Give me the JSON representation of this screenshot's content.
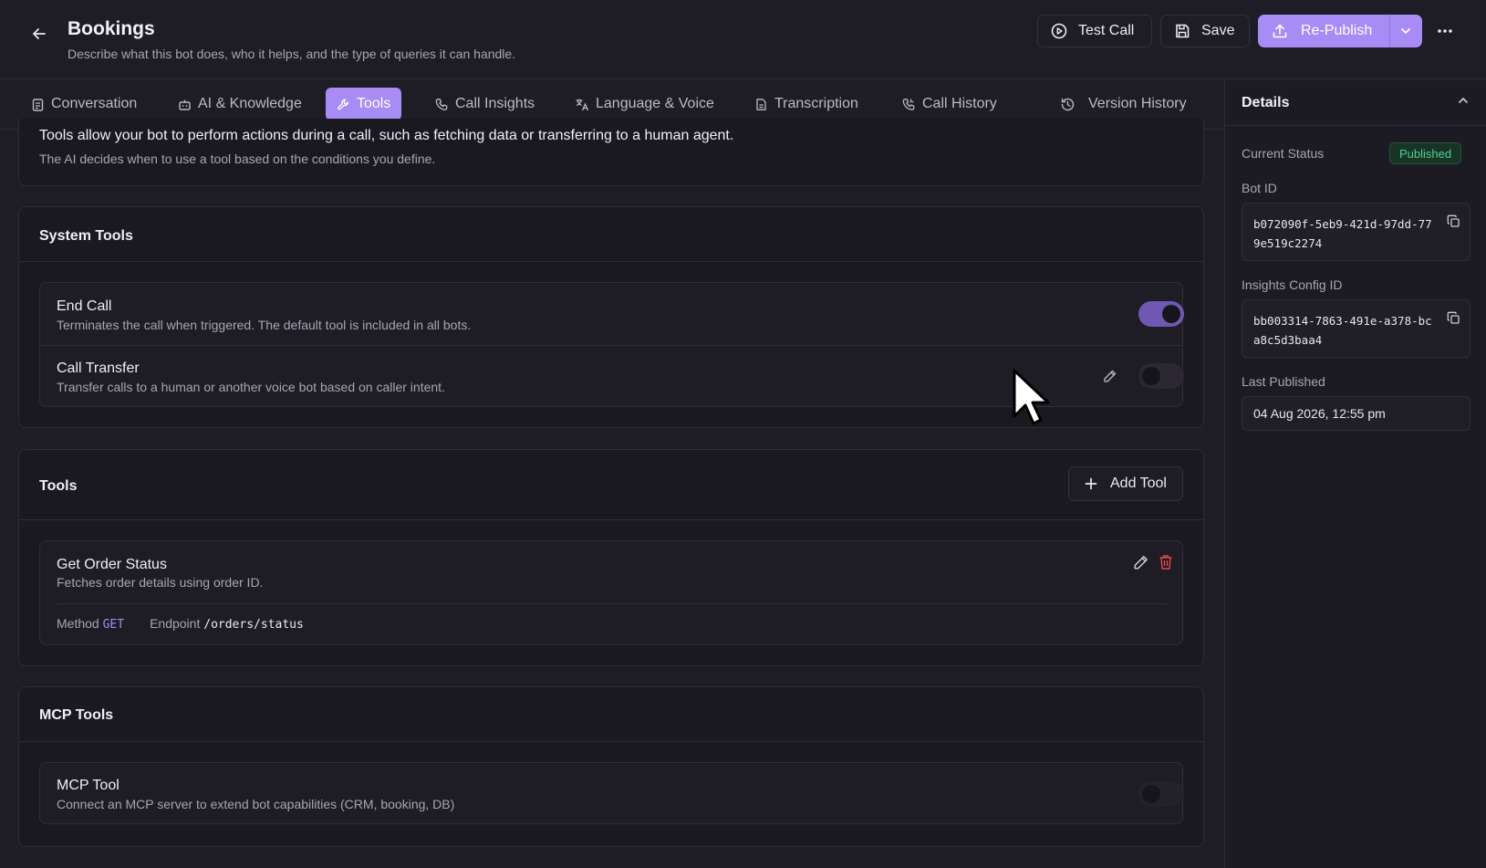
{
  "header": {
    "title": "Bookings",
    "subtitle": "Describe what this bot does, who it helps, and the type of queries it can handle.",
    "test_call_label": "Test Call",
    "save_label": "Save",
    "republish_label": "Re-Publish"
  },
  "tabs": [
    {
      "label": "Conversation",
      "icon": "clipboard-icon"
    },
    {
      "label": "AI & Knowledge",
      "icon": "bot-icon"
    },
    {
      "label": "Tools",
      "icon": "wrench-icon",
      "active": true
    },
    {
      "label": "Call Insights",
      "icon": "phone-icon"
    },
    {
      "label": "Language & Voice",
      "icon": "translate-icon"
    },
    {
      "label": "Transcription",
      "icon": "document-icon"
    },
    {
      "label": "Call History",
      "icon": "phone-history-icon"
    },
    {
      "label": "Version History",
      "icon": "history-icon"
    }
  ],
  "intro": {
    "main": "Tools allow your bot to perform actions during a call, such as fetching data or transferring to a human agent.",
    "sub": "The AI decides when to use a tool based on the conditions you define."
  },
  "system_tools": {
    "title": "System Tools",
    "items": [
      {
        "title": "End Call",
        "desc": "Terminates the call when triggered. The default tool is included in all bots.",
        "enabled": true
      },
      {
        "title": "Call Transfer",
        "desc": "Transfer calls to a human or another voice bot based on caller intent.",
        "enabled": false
      }
    ]
  },
  "tools": {
    "title": "Tools",
    "add_label": "Add Tool",
    "items": [
      {
        "title": "Get Order Status",
        "desc": "Fetches order details using order ID.",
        "method_label": "Method",
        "method": "GET",
        "endpoint_label": "Endpoint",
        "endpoint": "/orders/status"
      }
    ]
  },
  "mcp_tools": {
    "title": "MCP Tools",
    "items": [
      {
        "title": "MCP Tool",
        "desc": "Connect an MCP server to extend bot capabilities (CRM, booking, DB)",
        "enabled": false
      }
    ]
  },
  "details": {
    "title": "Details",
    "status_label": "Current Status",
    "status": "Published",
    "bot_id_label": "Bot ID",
    "bot_id": "b072090f-5eb9-421d-97dd-779e519c2274",
    "insights_label": "Insights Config ID",
    "insights_id": "bb003314-7863-491e-a378-bca8c5d3baa4",
    "published_label": "Last Published",
    "published": "04 Aug 2026, 12:55 pm"
  },
  "colors": {
    "accent": "#a98bf5",
    "status_green": "#4fd08a",
    "danger": "#e5484d"
  }
}
